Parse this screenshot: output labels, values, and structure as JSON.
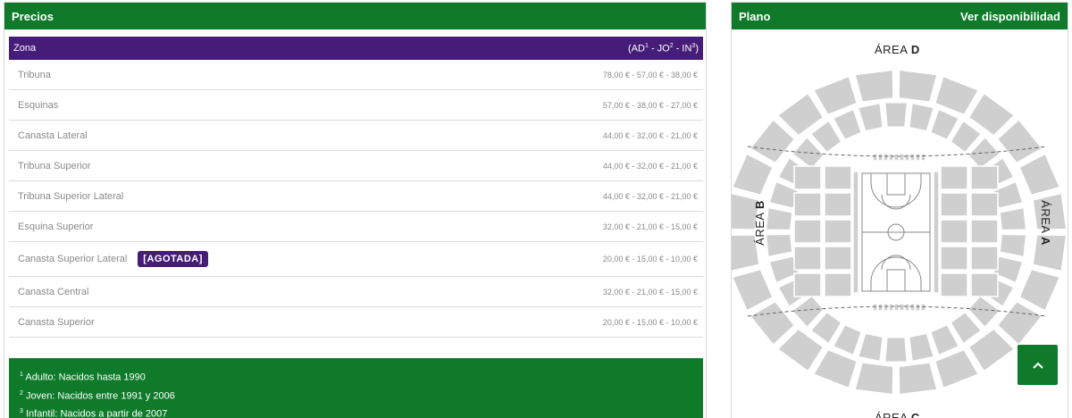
{
  "prices_panel": {
    "title": "Precios",
    "table": {
      "header_zone": "Zona",
      "header_prices_parts": [
        "(AD",
        "1",
        " - JO",
        "2",
        " - IN",
        "3",
        ")"
      ],
      "rows": [
        {
          "name": "Tribuna",
          "price": "78,00 € - 57,00 € - 38,00 €",
          "badge": ""
        },
        {
          "name": "Esquinas",
          "price": "57,00 € - 38,00 € - 27,00 €",
          "badge": ""
        },
        {
          "name": "Canasta Lateral",
          "price": "44,00 € - 32,00 € - 21,00 €",
          "badge": ""
        },
        {
          "name": "Tribuna Superior",
          "price": "44,00 € - 32,00 € - 21,00 €",
          "badge": ""
        },
        {
          "name": "Tribuna Superior Lateral",
          "price": "44,00 € - 32,00 € - 21,00 €",
          "badge": ""
        },
        {
          "name": "Esquina Superior",
          "price": "32,00 € - 21,00 € - 15,00 €",
          "badge": ""
        },
        {
          "name": "Canasta Superior Lateral",
          "price": "20,00 € - 15,00 € - 10,00 €",
          "badge": "[AGOTADA]"
        },
        {
          "name": "Canasta Central",
          "price": "32,00 € - 21,00 € - 15,00 €",
          "badge": ""
        },
        {
          "name": "Canasta Superior",
          "price": "20,00 € - 15,00 € - 10,00 €",
          "badge": ""
        }
      ]
    },
    "notes": [
      {
        "sup": "1",
        "text": " Adulto: Nacidos hasta 1990"
      },
      {
        "sup": "2",
        "text": " Joven: Nacidos entre 1991 y 2006"
      },
      {
        "sup": "3",
        "text": " Infantil: Nacidos a partir de 2007"
      }
    ]
  },
  "map_panel": {
    "title": "Plano",
    "availability_link": "Ver disponibilidad",
    "area_prefix": "ÁREA",
    "areas": {
      "top": "D",
      "bottom": "C",
      "left": "B",
      "right": "A"
    }
  },
  "scroll_top": {
    "icon": "chevron-up-icon"
  },
  "colors": {
    "green": "#0e7a2a",
    "purple": "#451c78",
    "seat_gray": "#cfcfcf"
  }
}
